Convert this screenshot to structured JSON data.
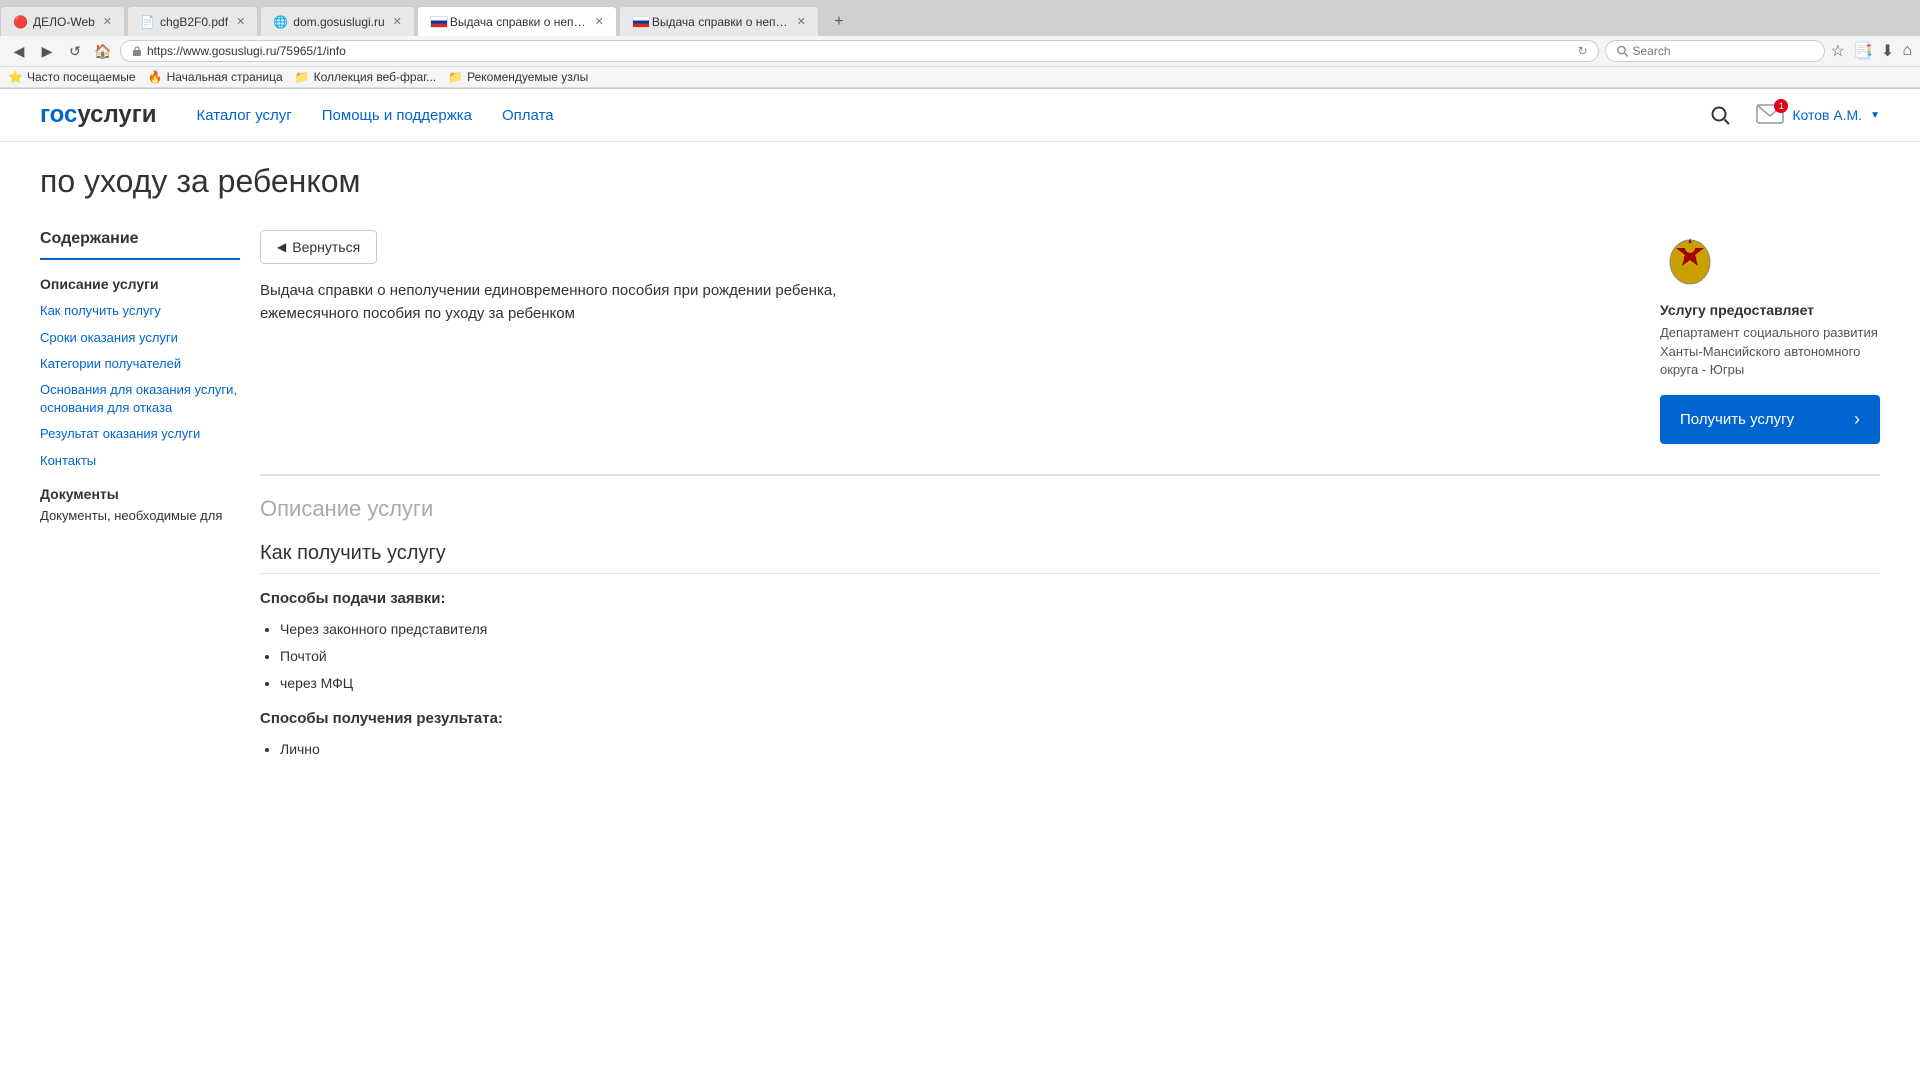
{
  "browser": {
    "tabs": [
      {
        "id": "tab1",
        "icon": "🔴",
        "title": "ДЕЛО-Web",
        "active": false,
        "closable": true
      },
      {
        "id": "tab2",
        "icon": "📄",
        "title": "chgB2F0.pdf",
        "active": false,
        "closable": true
      },
      {
        "id": "tab3",
        "icon": "🌐",
        "title": "dom.gosuslugi.ru",
        "active": false,
        "closable": true
      },
      {
        "id": "tab4",
        "icon": "🇷🇺",
        "title": "Выдача справки о непол...",
        "active": true,
        "closable": true
      },
      {
        "id": "tab5",
        "icon": "🇷🇺",
        "title": "Выдача справки о непол...",
        "active": false,
        "closable": true
      }
    ],
    "address": "https://www.gosuslugi.ru/75965/1/info",
    "search_placeholder": "Search"
  },
  "bookmarks": [
    {
      "label": "Часто посещаемые"
    },
    {
      "label": "Начальная страница"
    },
    {
      "label": "Коллекция веб-фраг..."
    },
    {
      "label": "Рекомендуемые узлы"
    }
  ],
  "site": {
    "logo_gos": "гос",
    "logo_uslugi": "услуги",
    "nav": [
      {
        "label": "Каталог услуг"
      },
      {
        "label": "Помощь и поддержка"
      },
      {
        "label": "Оплата"
      }
    ],
    "user_name": "Котов А.М.",
    "notification_count": "1"
  },
  "hero": {
    "title": "по уходу за ребенком"
  },
  "service": {
    "back_label": "Вернуться",
    "title": "Выдача справки о неполучении единовременного пособия при рождении ребенка, ежемесячного пособия по уходу за ребенком",
    "provider_title": "Услугу предоставляет",
    "provider_name": "Департамент социального развития Ханты-Мансийского автономного округа - Югры",
    "get_service_label": "Получить услугу"
  },
  "sidebar": {
    "title": "Содержание",
    "section1_title": "Описание услуги",
    "links": [
      {
        "label": "Как получить услугу"
      },
      {
        "label": "Сроки оказания услуги"
      },
      {
        "label": "Категории получателей"
      },
      {
        "label": "Основания для оказания услуги, основания для отказа"
      },
      {
        "label": "Результат оказания услуги"
      },
      {
        "label": "Контакты"
      }
    ],
    "docs_title": "Документы",
    "docs_sub": "Документы, необходимые для"
  },
  "content": {
    "section_main_title": "Описание услуги",
    "subsection_title": "Как получить услугу",
    "ways_label": "Способы подачи заявки:",
    "ways": [
      {
        "text": "Через законного представителя"
      },
      {
        "text": "Почтой"
      },
      {
        "text": "через МФЦ"
      }
    ],
    "result_label": "Способы получения результата:",
    "results": [
      {
        "text": "Лично"
      }
    ]
  }
}
